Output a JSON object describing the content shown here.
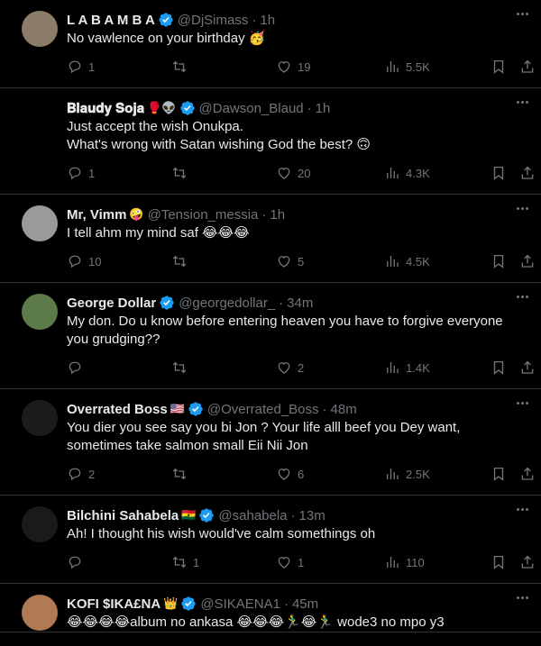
{
  "tweets": [
    {
      "name": "L A B A M B A",
      "verified": true,
      "extra_emoji": "",
      "handle": "@DjSimass",
      "time": "1h",
      "text": "No vawlence on your birthday 🥳",
      "replies": "1",
      "retweets": "",
      "likes": "19",
      "views": "5.5K",
      "avatar_color": "#8a7b6b"
    },
    {
      "name": "𝐁𝐥𝐚𝐮𝐝𝐲 𝐒𝐨𝐣𝐚",
      "verified": true,
      "extra_emoji": "🥊👽",
      "handle": "@Dawson_Blaud",
      "time": "1h",
      "text": "Just accept the wish Onukpa.\nWhat's wrong with Satan wishing God the best? 🙃",
      "replies": "1",
      "retweets": "",
      "likes": "20",
      "views": "4.3K",
      "avatar_color": "#000000"
    },
    {
      "name": "Mr, Vimm",
      "verified": false,
      "extra_emoji": "🤪",
      "handle": "@Tension_messia",
      "time": "1h",
      "text": "I tell ahm my mind saf 😂😂😂",
      "replies": "10",
      "retweets": "",
      "likes": "5",
      "views": "4.5K",
      "avatar_color": "#9a9a9a"
    },
    {
      "name": "George Dollar",
      "verified": true,
      "extra_emoji": "",
      "handle": "@georgedollar_",
      "time": "34m",
      "text": "My don. Do u know before entering heaven you have to forgive everyone you grudging??",
      "replies": "",
      "retweets": "",
      "likes": "2",
      "views": "1.4K",
      "avatar_color": "#5d7a4a"
    },
    {
      "name": "Overrated Boss",
      "verified": true,
      "extra_emoji": "🇺🇸",
      "handle": "@Overrated_Boss",
      "time": "48m",
      "text": "You dier you see say you bi Jon ? Your life alll beef you Dey want, sometimes take salmon small Eii Nii Jon",
      "replies": "2",
      "retweets": "",
      "likes": "6",
      "views": "2.5K",
      "avatar_color": "#1c1c1c"
    },
    {
      "name": "Bilchini Sahabela",
      "verified": true,
      "extra_emoji": "🇬🇭",
      "handle": "@sahabela",
      "time": "13m",
      "text": "Ah! I thought his wish would've calm somethings oh",
      "replies": "",
      "retweets": "1",
      "likes": "1",
      "views": "110",
      "avatar_color": "#1a1a1a"
    },
    {
      "name": "KOFI $IKA£NA",
      "verified": true,
      "extra_emoji": "👑",
      "handle": "@SIKAENA1",
      "time": "45m",
      "text": "😂😂😂😂album no ankasa 😂😂😂🏃‍♂️😂🏃‍♂️ wode3 no mpo y3",
      "replies": "",
      "retweets": "",
      "likes": "",
      "views": "",
      "avatar_color": "#b07a55"
    }
  ],
  "colors": {
    "background": "#000000",
    "text": "#e7e9ea",
    "muted": "#71767b",
    "verified": "#1d9bf0",
    "divider": "#2f3336"
  },
  "icons": {
    "verified": "verified-badge-icon",
    "reply": "reply-icon",
    "retweet": "retweet-icon",
    "like": "heart-icon",
    "views": "views-chart-icon",
    "bookmark": "bookmark-icon",
    "share": "share-icon",
    "more": "more-dots-icon"
  }
}
